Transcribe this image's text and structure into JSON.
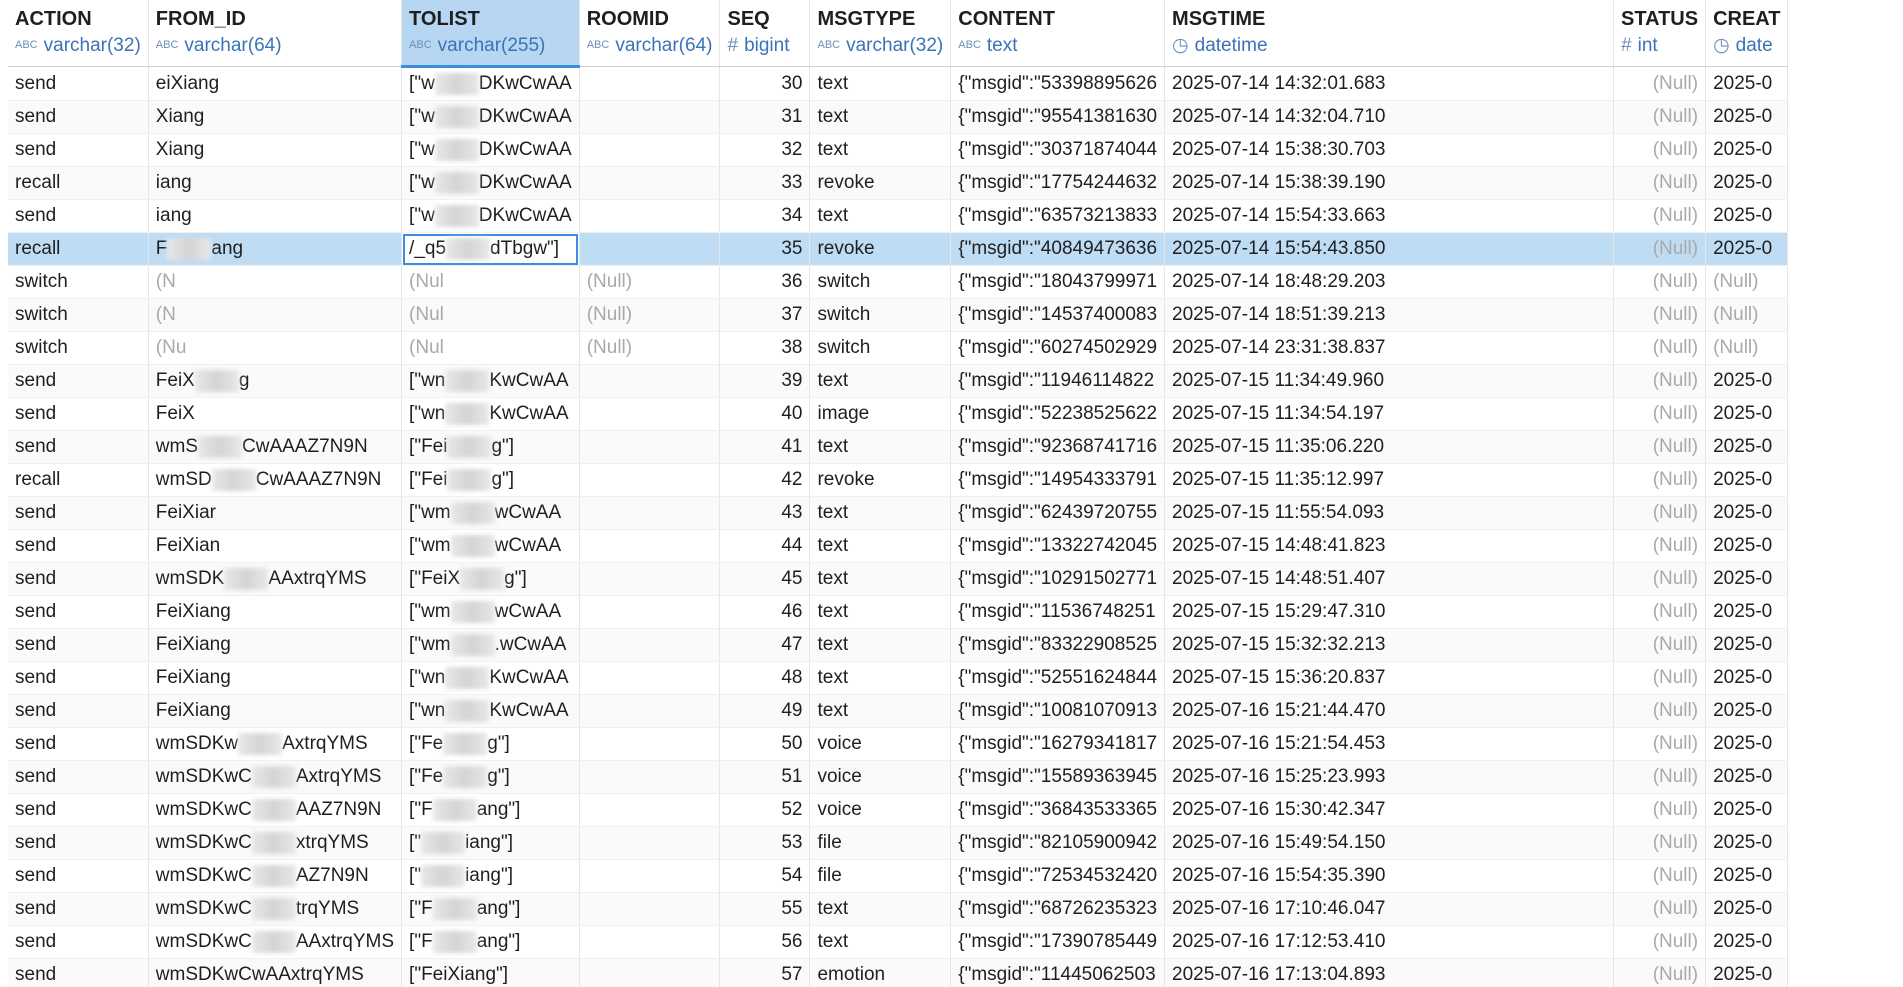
{
  "columns": [
    {
      "name": "ACTION",
      "icon": "abc-type-icon",
      "type": "varchar(32)"
    },
    {
      "name": "FROM_ID",
      "icon": "abc-type-icon",
      "type": "varchar(64)"
    },
    {
      "name": "TOLIST",
      "icon": "abc-type-icon",
      "type": "varchar(255)"
    },
    {
      "name": "ROOMID",
      "icon": "abc-type-icon",
      "type": "varchar(64)"
    },
    {
      "name": "SEQ",
      "icon": "hash-type-icon",
      "type": "bigint"
    },
    {
      "name": "MSGTYPE",
      "icon": "abc-type-icon",
      "type": "varchar(32)"
    },
    {
      "name": "CONTENT",
      "icon": "abc-type-icon",
      "type": "text"
    },
    {
      "name": "MSGTIME",
      "icon": "clock-type-icon",
      "type": "datetime"
    },
    {
      "name": "STATUS",
      "icon": "hash-type-icon",
      "type": "int"
    },
    {
      "name": "CREAT",
      "icon": "clock-type-icon",
      "type": "date"
    }
  ],
  "icon_glyphs": {
    "abc": "ABC",
    "hash": "#",
    "clock": "◷"
  },
  "null_label": "(Null)",
  "rows": [
    {
      "action": "send",
      "from_id": "eiXiang",
      "tolist": "[\"w",
      "roomid": "",
      "seq": "30",
      "msgtype": "text",
      "content": "{\"msgid\":\"53398895626",
      "msgtime": "2025-07-14 14:32:01.683",
      "status": "(Null)",
      "created": "2025-0",
      "tolist2": "DKwCwAA"
    },
    {
      "action": "send",
      "from_id": "Xiang",
      "tolist": "[\"w",
      "roomid": "",
      "seq": "31",
      "msgtype": "text",
      "content": "{\"msgid\":\"95541381630",
      "msgtime": "2025-07-14 14:32:04.710",
      "status": "(Null)",
      "created": "2025-0",
      "tolist2": "DKwCwAA"
    },
    {
      "action": "send",
      "from_id": "Xiang",
      "tolist": "[\"w",
      "roomid": "",
      "seq": "32",
      "msgtype": "text",
      "content": "{\"msgid\":\"30371874044",
      "msgtime": "2025-07-14 15:38:30.703",
      "status": "(Null)",
      "created": "2025-0",
      "tolist2": "DKwCwAA"
    },
    {
      "action": "recall",
      "from_id": "iang",
      "tolist": "[\"w",
      "roomid": "",
      "seq": "33",
      "msgtype": "revoke",
      "content": "{\"msgid\":\"17754244632",
      "msgtime": "2025-07-14 15:38:39.190",
      "status": "(Null)",
      "created": "2025-0",
      "tolist2": "DKwCwAA"
    },
    {
      "action": "send",
      "from_id": "iang",
      "tolist": "[\"w",
      "roomid": "",
      "seq": "34",
      "msgtype": "text",
      "content": "{\"msgid\":\"63573213833",
      "msgtime": "2025-07-14 15:54:33.663",
      "status": "(Null)",
      "created": "2025-0",
      "tolist2": "DKwCwAA"
    },
    {
      "action": "recall",
      "from_id": "F",
      "from_id2": "ang",
      "tolist": "/_q5",
      "roomid": "",
      "seq": "35",
      "msgtype": "revoke",
      "content": "{\"msgid\":\"40849473636",
      "msgtime": "2025-07-14 15:54:43.850",
      "status": "(Null)",
      "created": "2025-0",
      "tolist2": "dTbgw\"]"
    },
    {
      "action": "switch",
      "from_id": "(N",
      "tolist": "(Nul",
      "roomid": "(Null)",
      "seq": "36",
      "msgtype": "switch",
      "content": "{\"msgid\":\"18043799971",
      "msgtime": "2025-07-14 18:48:29.203",
      "status": "(Null)",
      "created": "(Null)",
      "tolist2": ""
    },
    {
      "action": "switch",
      "from_id": "(N",
      "tolist": "(Nul",
      "roomid": "(Null)",
      "seq": "37",
      "msgtype": "switch",
      "content": "{\"msgid\":\"14537400083",
      "msgtime": "2025-07-14 18:51:39.213",
      "status": "(Null)",
      "created": "(Null)",
      "tolist2": ""
    },
    {
      "action": "switch",
      "from_id": "(Nu",
      "tolist": "(Nul",
      "roomid": "(Null)",
      "seq": "38",
      "msgtype": "switch",
      "content": "{\"msgid\":\"60274502929",
      "msgtime": "2025-07-14 23:31:38.837",
      "status": "(Null)",
      "created": "(Null)",
      "tolist2": ""
    },
    {
      "action": "send",
      "from_id": "FeiX",
      "from_id2": "g",
      "tolist": "[\"wn",
      "roomid": "",
      "seq": "39",
      "msgtype": "text",
      "content": "{\"msgid\":\"11946114822",
      "msgtime": "2025-07-15 11:34:49.960",
      "status": "(Null)",
      "created": "2025-0",
      "tolist2": "KwCwAA"
    },
    {
      "action": "send",
      "from_id": "FeiX",
      "tolist": "[\"wn",
      "roomid": "",
      "seq": "40",
      "msgtype": "image",
      "content": "{\"msgid\":\"52238525622",
      "msgtime": "2025-07-15 11:34:54.197",
      "status": "(Null)",
      "created": "2025-0",
      "tolist2": "KwCwAA"
    },
    {
      "action": "send",
      "from_id": "wmS",
      "from_id2": "CwAAAZ7N9N",
      "tolist": "[\"Fei",
      "roomid": "",
      "seq": "41",
      "msgtype": "text",
      "content": "{\"msgid\":\"92368741716",
      "msgtime": "2025-07-15 11:35:06.220",
      "status": "(Null)",
      "created": "2025-0",
      "tolist2": "g\"]"
    },
    {
      "action": "recall",
      "from_id": "wmSD",
      "from_id2": "CwAAAZ7N9N",
      "tolist": "[\"Fei",
      "roomid": "",
      "seq": "42",
      "msgtype": "revoke",
      "content": "{\"msgid\":\"14954333791",
      "msgtime": "2025-07-15 11:35:12.997",
      "status": "(Null)",
      "created": "2025-0",
      "tolist2": "g\"]"
    },
    {
      "action": "send",
      "from_id": "FeiXiar",
      "tolist": "[\"wm",
      "roomid": "",
      "seq": "43",
      "msgtype": "text",
      "content": "{\"msgid\":\"62439720755",
      "msgtime": "2025-07-15 11:55:54.093",
      "status": "(Null)",
      "created": "2025-0",
      "tolist2": "wCwAA"
    },
    {
      "action": "send",
      "from_id": "FeiXian",
      "tolist": "[\"wm",
      "roomid": "",
      "seq": "44",
      "msgtype": "text",
      "content": "{\"msgid\":\"13322742045",
      "msgtime": "2025-07-15 14:48:41.823",
      "status": "(Null)",
      "created": "2025-0",
      "tolist2": "wCwAA"
    },
    {
      "action": "send",
      "from_id": "wmSDK",
      "from_id2": "AAxtrqYMS",
      "tolist": "[\"FeiX",
      "roomid": "",
      "seq": "45",
      "msgtype": "text",
      "content": "{\"msgid\":\"10291502771",
      "msgtime": "2025-07-15 14:48:51.407",
      "status": "(Null)",
      "created": "2025-0",
      "tolist2": "g\"]"
    },
    {
      "action": "send",
      "from_id": "FeiXiang",
      "tolist": "[\"wm",
      "roomid": "",
      "seq": "46",
      "msgtype": "text",
      "content": "{\"msgid\":\"11536748251",
      "msgtime": "2025-07-15 15:29:47.310",
      "status": "(Null)",
      "created": "2025-0",
      "tolist2": "wCwAA"
    },
    {
      "action": "send",
      "from_id": "FeiXiang",
      "tolist": "[\"wm",
      "roomid": "",
      "seq": "47",
      "msgtype": "text",
      "content": "{\"msgid\":\"83322908525",
      "msgtime": "2025-07-15 15:32:32.213",
      "status": "(Null)",
      "created": "2025-0",
      "tolist2": ".wCwAA"
    },
    {
      "action": "send",
      "from_id": "FeiXiang",
      "tolist": "[\"wn",
      "roomid": "",
      "seq": "48",
      "msgtype": "text",
      "content": "{\"msgid\":\"52551624844",
      "msgtime": "2025-07-15 15:36:20.837",
      "status": "(Null)",
      "created": "2025-0",
      "tolist2": "KwCwAA"
    },
    {
      "action": "send",
      "from_id": "FeiXiang",
      "tolist": "[\"wn",
      "roomid": "",
      "seq": "49",
      "msgtype": "text",
      "content": "{\"msgid\":\"10081070913",
      "msgtime": "2025-07-16 15:21:44.470",
      "status": "(Null)",
      "created": "2025-0",
      "tolist2": "KwCwAA"
    },
    {
      "action": "send",
      "from_id": "wmSDKw",
      "from_id2": "AxtrqYMS",
      "tolist": "[\"Fe",
      "roomid": "",
      "seq": "50",
      "msgtype": "voice",
      "content": "{\"msgid\":\"16279341817",
      "msgtime": "2025-07-16 15:21:54.453",
      "status": "(Null)",
      "created": "2025-0",
      "tolist2": "g\"]"
    },
    {
      "action": "send",
      "from_id": "wmSDKwC",
      "from_id2": "AxtrqYMS",
      "tolist": "[\"Fe",
      "roomid": "",
      "seq": "51",
      "msgtype": "voice",
      "content": "{\"msgid\":\"15589363945",
      "msgtime": "2025-07-16 15:25:23.993",
      "status": "(Null)",
      "created": "2025-0",
      "tolist2": "g\"]"
    },
    {
      "action": "send",
      "from_id": "wmSDKwC",
      "from_id2": "AAZ7N9N",
      "tolist": "[\"F",
      "roomid": "",
      "seq": "52",
      "msgtype": "voice",
      "content": "{\"msgid\":\"36843533365",
      "msgtime": "2025-07-16 15:30:42.347",
      "status": "(Null)",
      "created": "2025-0",
      "tolist2": "ang\"]"
    },
    {
      "action": "send",
      "from_id": "wmSDKwC",
      "from_id2": "xtrqYMS",
      "tolist": "[\"",
      "roomid": "",
      "seq": "53",
      "msgtype": "file",
      "content": "{\"msgid\":\"82105900942",
      "msgtime": "2025-07-16 15:49:54.150",
      "status": "(Null)",
      "created": "2025-0",
      "tolist2": "iang\"]"
    },
    {
      "action": "send",
      "from_id": "wmSDKwC",
      "from_id2": "AZ7N9N",
      "tolist": "[\"",
      "roomid": "",
      "seq": "54",
      "msgtype": "file",
      "content": "{\"msgid\":\"72534532420",
      "msgtime": "2025-07-16 15:54:35.390",
      "status": "(Null)",
      "created": "2025-0",
      "tolist2": "iang\"]"
    },
    {
      "action": "send",
      "from_id": "wmSDKwC",
      "from_id2": "trqYMS",
      "tolist": "[\"F",
      "roomid": "",
      "seq": "55",
      "msgtype": "text",
      "content": "{\"msgid\":\"68726235323",
      "msgtime": "2025-07-16 17:10:46.047",
      "status": "(Null)",
      "created": "2025-0",
      "tolist2": "ang\"]"
    },
    {
      "action": "send",
      "from_id": "wmSDKwC",
      "from_id2": "AAxtrqYMS",
      "tolist": "[\"F",
      "roomid": "",
      "seq": "56",
      "msgtype": "text",
      "content": "{\"msgid\":\"17390785449",
      "msgtime": "2025-07-16 17:12:53.410",
      "status": "(Null)",
      "created": "2025-0",
      "tolist2": "ang\"]"
    },
    {
      "action": "send",
      "from_id": "wmSDKwCwAAxtrqYMS",
      "tolist": "[\"FeiXiang\"]",
      "roomid": "",
      "seq": "57",
      "msgtype": "emotion",
      "content": "{\"msgid\":\"11445062503",
      "msgtime": "2025-07-16 17:13:04.893",
      "status": "(Null)",
      "created": "2025-0",
      "tolist2": ""
    }
  ],
  "selected_row_index": 5,
  "selected_column": "TOLIST",
  "colors": {
    "accent": "#3b8de0",
    "selected_row": "#bfdcf5",
    "selected_header": "#b7d6f2",
    "type_text": "#3a73b8",
    "null_text": "#a9a9a9"
  }
}
